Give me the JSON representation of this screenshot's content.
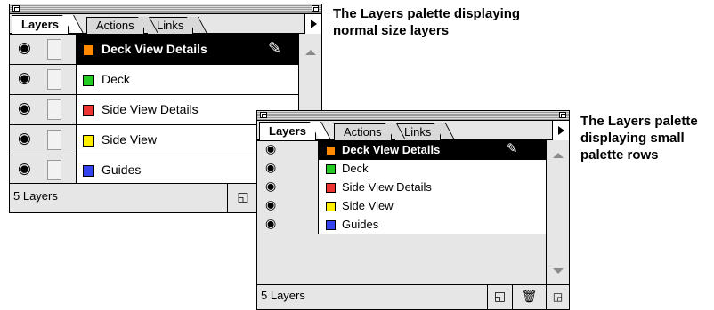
{
  "captions": {
    "normal": [
      "The Layers palette displaying",
      "normal size layers"
    ],
    "small": [
      "The Layers palette",
      "displaying small",
      "palette rows"
    ]
  },
  "tabs": [
    "Layers",
    "Actions",
    "Links"
  ],
  "layers": [
    {
      "name": "Deck View Details",
      "color": "#ff8a00",
      "selected": true
    },
    {
      "name": "Deck",
      "color": "#22cc22",
      "selected": false
    },
    {
      "name": "Side View Details",
      "color": "#ee3333",
      "selected": false
    },
    {
      "name": "Side View",
      "color": "#ffee00",
      "selected": false
    },
    {
      "name": "Guides",
      "color": "#3344ee",
      "selected": false
    }
  ],
  "footer": {
    "count_label": "5 Layers"
  },
  "icons": {
    "eye": "eye-icon",
    "pen": "pen-icon",
    "new_layer": "new-layer-icon",
    "trash": "trash-icon",
    "resize": "resize-grip-icon",
    "menu": "palette-menu-icon"
  }
}
